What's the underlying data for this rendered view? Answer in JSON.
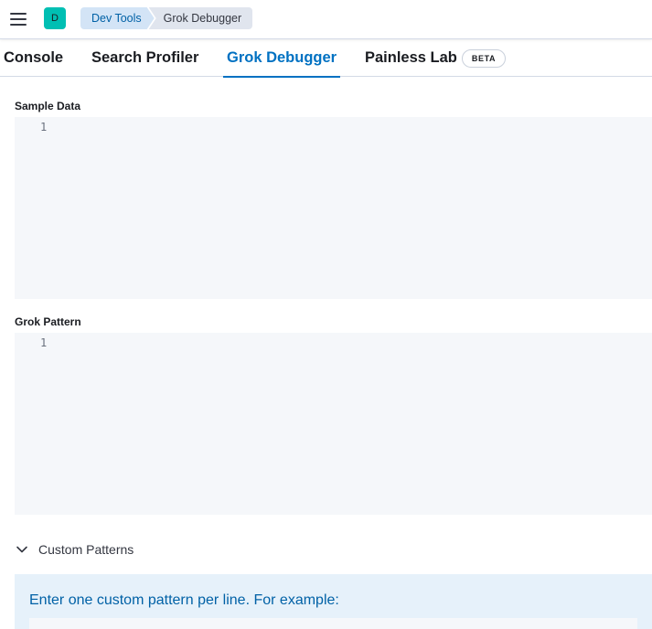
{
  "header": {
    "avatar_initial": "D",
    "breadcrumbs": [
      "Dev Tools",
      "Grok Debugger"
    ]
  },
  "tabs": [
    {
      "label": "Console",
      "active": false
    },
    {
      "label": "Search Profiler",
      "active": false
    },
    {
      "label": "Grok Debugger",
      "active": true
    },
    {
      "label": "Painless Lab",
      "active": false,
      "badge": "BETA"
    }
  ],
  "sample_data": {
    "label": "Sample Data",
    "line_numbers": [
      "1"
    ],
    "value": ""
  },
  "grok_pattern": {
    "label": "Grok Pattern",
    "line_numbers": [
      "1"
    ],
    "value": ""
  },
  "custom_patterns": {
    "label": "Custom Patterns",
    "expanded": true,
    "help_text": "Enter one custom pattern per line. For example:"
  },
  "colors": {
    "accent": "#0071c2",
    "avatar": "#00bfb3",
    "callout_bg": "#e6f1fa",
    "editor_bg": "#f5f7fa"
  }
}
